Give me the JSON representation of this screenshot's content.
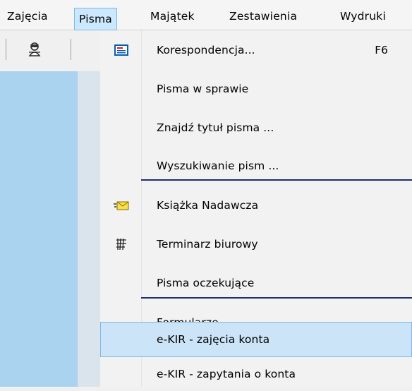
{
  "menubar": {
    "items": [
      {
        "label": "Zajęcia"
      },
      {
        "label": "Pisma"
      },
      {
        "label": "Majątek"
      },
      {
        "label": "Zestawienia"
      },
      {
        "label": "Wydruki"
      }
    ],
    "active_index": 1
  },
  "toolbar": {
    "button_icon": "user-ghost-icon"
  },
  "dropdown": {
    "items": [
      {
        "label": "Korespondencja...",
        "shortcut": "F6",
        "icon": "envelope-form-icon"
      },
      {
        "label": "Pisma w sprawie"
      },
      {
        "label": "Znajdź tytuł pisma ..."
      },
      {
        "label": "Wyszukiwanie pism ..."
      },
      {
        "label": "Książka Nadawcza",
        "icon": "mail-letter-icon"
      },
      {
        "label": "Terminarz biurowy",
        "icon": "calendar-grid-icon"
      },
      {
        "label": "Pisma oczekujące"
      },
      {
        "label": "Formularze"
      },
      {
        "label": "e-KIR - zajęcia konta",
        "highlighted": true
      },
      {
        "label": "e-KIR - zapytania o konta"
      }
    ]
  },
  "colors": {
    "highlight_bg": "#cce4f7",
    "highlight_border": "#7fb8e6",
    "divider": "#1f2f6b",
    "client_bg": "#a9d3ef"
  }
}
